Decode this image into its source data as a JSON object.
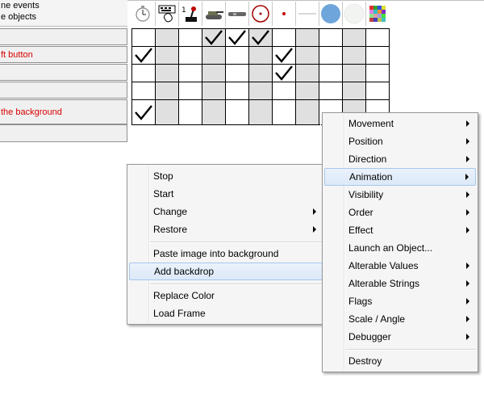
{
  "header": {
    "line1": "ne events",
    "line2": "e objects"
  },
  "rows": [
    {
      "label": ""
    },
    {
      "label": "ft button"
    },
    {
      "label": ""
    },
    {
      "label": ""
    },
    {
      "label": "the background"
    },
    {
      "label": ""
    }
  ],
  "object_icons": [
    "timer-icon",
    "keyboard-mouse-icon",
    "player-joystick-icon",
    "tank-icon",
    "bat-icon",
    "target-circle-icon",
    "red-dot-icon",
    "line-icon",
    "blue-circle-icon",
    "white-circle-icon",
    "color-palette-icon"
  ],
  "checks": [
    {
      "row": 0,
      "col": 3
    },
    {
      "row": 0,
      "col": 4
    },
    {
      "row": 0,
      "col": 5
    },
    {
      "row": 1,
      "col": 0
    },
    {
      "row": 1,
      "col": 6
    },
    {
      "row": 2,
      "col": 6
    },
    {
      "row": 4,
      "col": 0
    }
  ],
  "context_menu_left": {
    "items": [
      {
        "label": "Stop",
        "submenu": false
      },
      {
        "label": "Start",
        "submenu": false
      },
      {
        "label": "Change",
        "submenu": true
      },
      {
        "label": "Restore",
        "submenu": true
      },
      {
        "label": "Paste image into background",
        "submenu": false
      },
      {
        "label": "Add backdrop",
        "submenu": false,
        "highlighted": true
      },
      {
        "label": "Replace Color",
        "submenu": false
      },
      {
        "label": "Load Frame",
        "submenu": false
      }
    ]
  },
  "context_menu_right": {
    "items": [
      {
        "label": "Movement",
        "submenu": true
      },
      {
        "label": "Position",
        "submenu": true
      },
      {
        "label": "Direction",
        "submenu": true
      },
      {
        "label": "Animation",
        "submenu": true,
        "highlighted": true
      },
      {
        "label": "Visibility",
        "submenu": true
      },
      {
        "label": "Order",
        "submenu": true
      },
      {
        "label": "Effect",
        "submenu": true
      },
      {
        "label": "Launch an Object...",
        "submenu": false
      },
      {
        "label": "Alterable Values",
        "submenu": true
      },
      {
        "label": "Alterable Strings",
        "submenu": true
      },
      {
        "label": "Flags",
        "submenu": true
      },
      {
        "label": "Scale / Angle",
        "submenu": true
      },
      {
        "label": "Debugger",
        "submenu": true
      },
      {
        "label": "Destroy",
        "submenu": false
      }
    ]
  }
}
